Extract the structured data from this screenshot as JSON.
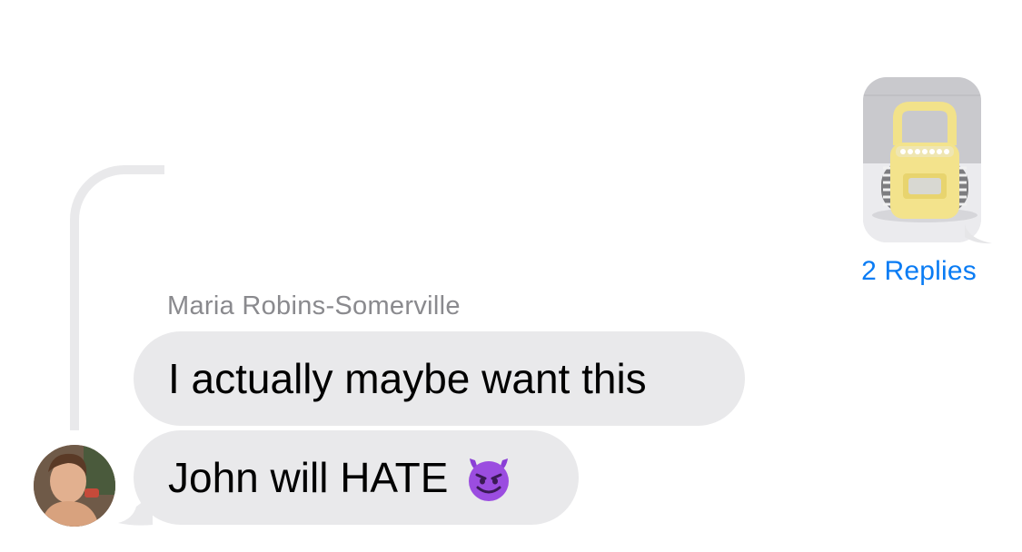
{
  "thread": {
    "replies_label": "2 Replies"
  },
  "outgoing": {
    "image": "photo-yellow-boombox"
  },
  "incoming": {
    "sender_name": "Maria Robins-Somerville",
    "messages": [
      {
        "text": "I actually maybe want this"
      },
      {
        "text": "John will HATE",
        "emoji": "smiling-face-with-horns"
      }
    ],
    "avatar": "user-photo"
  },
  "colors": {
    "incoming_bubble": "#e9e9eb",
    "link_blue": "#0a7cf4",
    "sender_gray": "#8a8a8e",
    "background": "#ffffff"
  }
}
